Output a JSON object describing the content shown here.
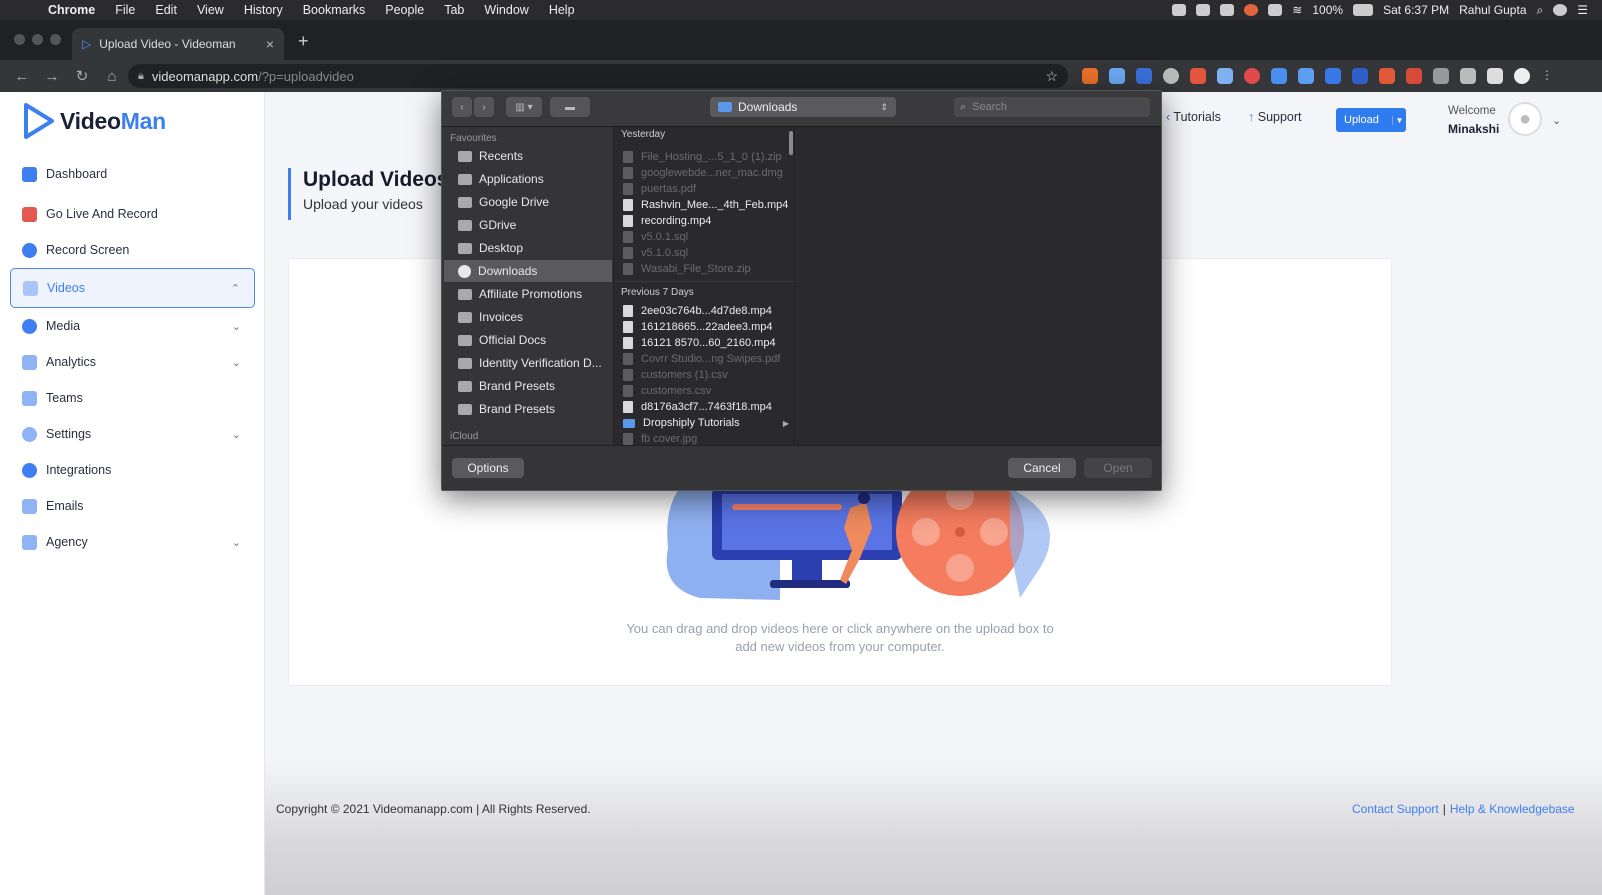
{
  "menubar": {
    "app": "Chrome",
    "items": [
      "File",
      "Edit",
      "View",
      "History",
      "Bookmarks",
      "People",
      "Tab",
      "Window",
      "Help"
    ],
    "battery": "100%",
    "clock": "Sat 6:37 PM",
    "user": "Rahul Gupta"
  },
  "browser": {
    "tab_title": "Upload Video - Videoman",
    "url_host": "videomanapp.com",
    "url_path": "/?p=uploadvideo"
  },
  "brand": {
    "name_a": "Video",
    "name_b": "Man"
  },
  "sidebar": {
    "items": [
      {
        "label": "Dashboard",
        "icon": "dashboard-icon",
        "color": "#3d7ff0"
      },
      {
        "label": "Go Live And Record",
        "icon": "live-icon",
        "color": "#e25a4f"
      },
      {
        "label": "Record Screen",
        "icon": "record-icon",
        "color": "#3d7ff0"
      },
      {
        "label": "Videos",
        "icon": "video-icon",
        "color": "#3d7ff0",
        "active": true
      },
      {
        "label": "Media",
        "icon": "media-icon",
        "color": "#3d7ff0"
      },
      {
        "label": "Analytics",
        "icon": "analytics-icon",
        "color": "#3d7ff0"
      },
      {
        "label": "Teams",
        "icon": "teams-icon",
        "color": "#3d7ff0"
      },
      {
        "label": "Settings",
        "icon": "gear-icon",
        "color": "#3d7ff0"
      },
      {
        "label": "Integrations",
        "icon": "integrations-icon",
        "color": "#3d7ff0"
      },
      {
        "label": "Emails",
        "icon": "email-icon",
        "color": "#3d7ff0"
      },
      {
        "label": "Agency",
        "icon": "agency-icon",
        "color": "#3d7ff0"
      }
    ]
  },
  "header": {
    "tutorials": "Tutorials",
    "support": "Support",
    "upload": "Upload",
    "welcome": "Welcome",
    "username": "Minakshi"
  },
  "page": {
    "title": "Upload Videos",
    "subtitle": "Upload your videos",
    "hint": "You can drag and drop videos here or click anywhere on the upload box to add new videos from your computer."
  },
  "footer": {
    "copyright": "Copyright © 2021 Videomanapp.com | All Rights Reserved.",
    "contact": "Contact Support",
    "help": "Help & Knowledgebase"
  },
  "dialog": {
    "location": "Downloads",
    "search_placeholder": "Search",
    "favourites_label": "Favourites",
    "icloud_label": "iCloud",
    "sidebar": [
      "Recents",
      "Applications",
      "Google Drive",
      "GDrive",
      "Desktop",
      "Downloads",
      "Affiliate Promotions",
      "Invoices",
      "Official Docs",
      "Identity Verification D...",
      "Brand Presets",
      "Brand Presets"
    ],
    "selected_index": 5,
    "yesterday_label": "Yesterday",
    "previous_label": "Previous 7 Days",
    "yesterday_files": [
      {
        "name": "File_Hosting_...5_1_0 (1).zip",
        "dim": true
      },
      {
        "name": "googlewebde...ner_mac.dmg",
        "dim": true
      },
      {
        "name": "puertas.pdf",
        "dim": true
      },
      {
        "name": "Rashvin_Mee..._4th_Feb.mp4",
        "dim": false
      },
      {
        "name": "recording.mp4",
        "dim": false
      },
      {
        "name": "v5.0.1.sql",
        "dim": true
      },
      {
        "name": "v5.1.0.sql",
        "dim": true
      },
      {
        "name": "Wasabi_File_Store.zip",
        "dim": true
      }
    ],
    "previous_files": [
      {
        "name": "2ee03c764b...4d7de8.mp4",
        "dim": false
      },
      {
        "name": "161218665...22adee3.mp4",
        "dim": false
      },
      {
        "name": "16121 8570...60_2160.mp4",
        "dim": false
      },
      {
        "name": "Covrr Studio...ng Swipes.pdf",
        "dim": true
      },
      {
        "name": "customers (1).csv",
        "dim": true
      },
      {
        "name": "customers.csv",
        "dim": true
      },
      {
        "name": "d8176a3cf7...7463f18.mp4",
        "dim": false
      },
      {
        "name": "Dropshiply Tutorials",
        "dim": false,
        "folder": true
      },
      {
        "name": "fb cover.jpg",
        "dim": true
      }
    ],
    "options": "Options",
    "cancel": "Cancel",
    "open": "Open"
  }
}
